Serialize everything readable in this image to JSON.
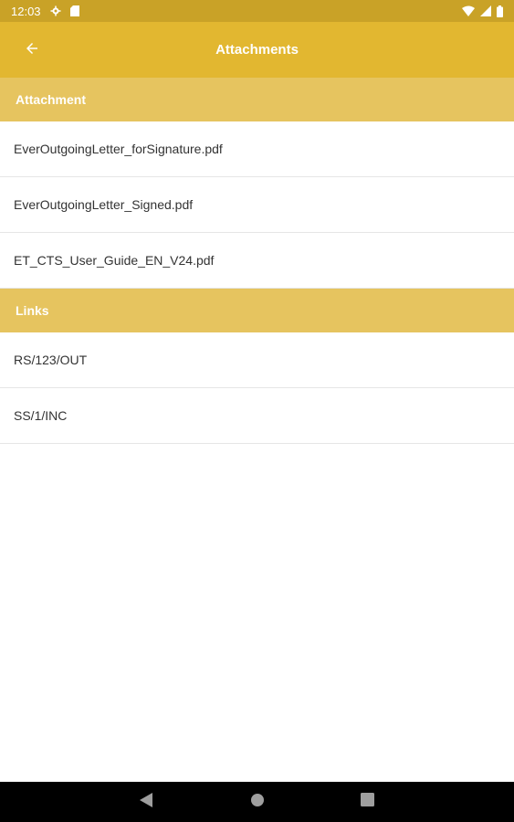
{
  "status_bar": {
    "time": "12:03",
    "icons_left": [
      "gear-icon",
      "sd-card-icon"
    ],
    "icons_right": [
      "wifi-icon",
      "signal-icon",
      "battery-icon"
    ]
  },
  "app_bar": {
    "title": "Attachments",
    "back_icon": "arrow-back-icon"
  },
  "sections": {
    "attachments": {
      "header": "Attachment",
      "items": [
        "EverOutgoingLetter_forSignature.pdf",
        "EverOutgoingLetter_Signed.pdf",
        "ET_CTS_User_Guide_EN_V24.pdf"
      ]
    },
    "links": {
      "header": "Links",
      "items": [
        "RS/123/OUT",
        "SS/1/INC"
      ]
    }
  },
  "nav_bar": {
    "icons": [
      "back-triangle-icon",
      "home-circle-icon",
      "recents-square-icon"
    ]
  },
  "colors": {
    "status_bar": "#c9a227",
    "app_bar": "#e2b730",
    "section_header": "#e6c45f",
    "nav_bar": "#000000"
  }
}
